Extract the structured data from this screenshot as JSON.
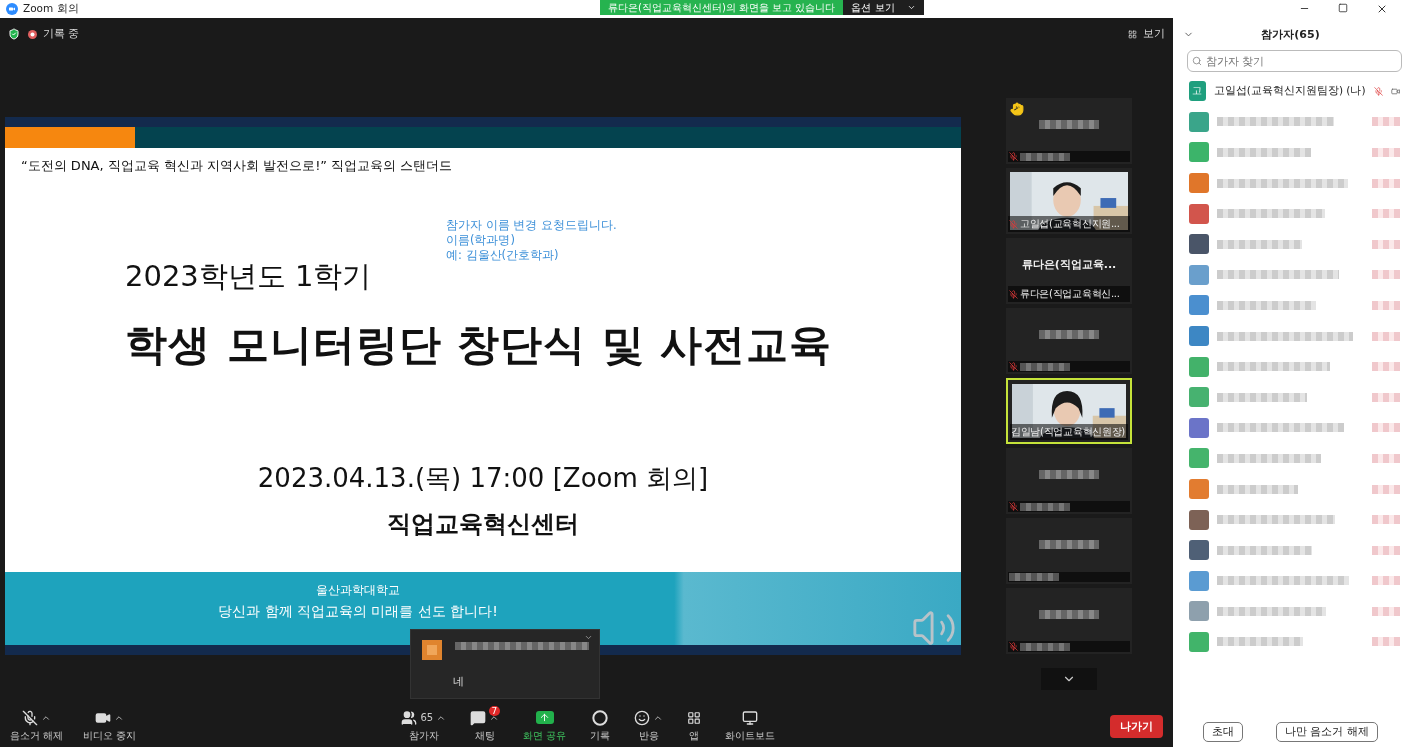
{
  "window": {
    "title": "Zoom 회의"
  },
  "share_banner": {
    "text": "류다은(직업교육혁신센터)의 화면을 보고 있습니다",
    "button": "옵션 보기"
  },
  "top_strip": {
    "recording": "기록 중",
    "view": "보기"
  },
  "slide": {
    "tagline": "“도전의 DNA, 직업교육 혁신과 지역사회 발전으로!” 직업교육의 스탠더드",
    "notice": [
      "참가자 이름 변경 요청드립니다.",
      "이름(학과명)",
      "예: 김울산(간호학과)"
    ],
    "subtitle": "2023학년도 1학기",
    "title": "학생 모니터링단 창단식 및 사전교육",
    "date": "2023.04.13.(목) 17:00 [Zoom 회의]",
    "org": "직업교육혁신센터",
    "school": "울산과학대학교",
    "slogan": "당신과 함께 직업교육의 미래를 선도 합니다!"
  },
  "gallery": [
    {
      "kind": "blurred",
      "hand": true,
      "muted": true,
      "selected": false
    },
    {
      "kind": "video",
      "label": "고일섭(교육혁신지원...",
      "hand": false,
      "muted": true,
      "selected": false
    },
    {
      "kind": "name",
      "title": "류다은(직업교육...",
      "label": "류다은(직업교육혁신...",
      "hand": false,
      "muted": true,
      "selected": false
    },
    {
      "kind": "blurred",
      "hand": false,
      "muted": true,
      "selected": false
    },
    {
      "kind": "video",
      "label": "김일남(직업교육혁신원장)",
      "hand": false,
      "muted": false,
      "selected": true
    },
    {
      "kind": "blurred",
      "hand": false,
      "muted": true,
      "selected": false
    },
    {
      "kind": "blurred",
      "hand": false,
      "muted": false,
      "selected": false
    },
    {
      "kind": "blurred",
      "hand": false,
      "muted": true,
      "selected": false
    }
  ],
  "chat_popup": {
    "message": "네"
  },
  "toolbar": [
    {
      "kind": "mic",
      "label": "음소거 해제",
      "caret": true
    },
    {
      "kind": "video",
      "label": "비디오 중지",
      "caret": true
    },
    {
      "kind": "participants",
      "label": "참가자",
      "count": "65",
      "caret": true
    },
    {
      "kind": "chat",
      "label": "채팅",
      "badge": "7",
      "caret": true
    },
    {
      "kind": "share",
      "label": "화면 공유",
      "caret": false
    },
    {
      "kind": "record",
      "label": "기록",
      "caret": false
    },
    {
      "kind": "reactions",
      "label": "반응",
      "caret": true
    },
    {
      "kind": "apps",
      "label": "앱",
      "caret": false
    },
    {
      "kind": "whiteboard",
      "label": "화이트보드",
      "caret": false
    }
  ],
  "leave_button": "나가기",
  "participants_panel": {
    "title": "참가자(65)",
    "search": {
      "placeholder": "참가자 찾기"
    },
    "rows": [
      {
        "kind": "named",
        "initial": "고",
        "name": "고일섭(교육혁신지원팀장) (나)",
        "color": "#1f9f7e"
      },
      {
        "kind": "blurred",
        "color": "#3aa58a"
      },
      {
        "kind": "blurred",
        "color": "#3cb46a"
      },
      {
        "kind": "blurred",
        "color": "#e0762a"
      },
      {
        "kind": "blurred",
        "color": "#d2554c"
      },
      {
        "kind": "blurred",
        "color": "#4a5568"
      },
      {
        "kind": "blurred",
        "color": "#6a9fcc"
      },
      {
        "kind": "blurred",
        "color": "#4b8fcf"
      },
      {
        "kind": "blurred",
        "color": "#3d87c4"
      },
      {
        "kind": "blurred",
        "color": "#43b26a"
      },
      {
        "kind": "blurred",
        "color": "#47b270"
      },
      {
        "kind": "blurred",
        "color": "#6b74c8"
      },
      {
        "kind": "blurred",
        "color": "#45b46c"
      },
      {
        "kind": "blurred",
        "color": "#e27c30"
      },
      {
        "kind": "blurred",
        "color": "#7d6256"
      },
      {
        "kind": "blurred",
        "color": "#4f6076"
      },
      {
        "kind": "blurred",
        "color": "#5a9bd2"
      },
      {
        "kind": "blurred",
        "color": "#8ea0ad"
      },
      {
        "kind": "blurred",
        "color": "#41b46a"
      }
    ],
    "buttons": [
      "초대",
      "나만 음소거 해제"
    ]
  }
}
